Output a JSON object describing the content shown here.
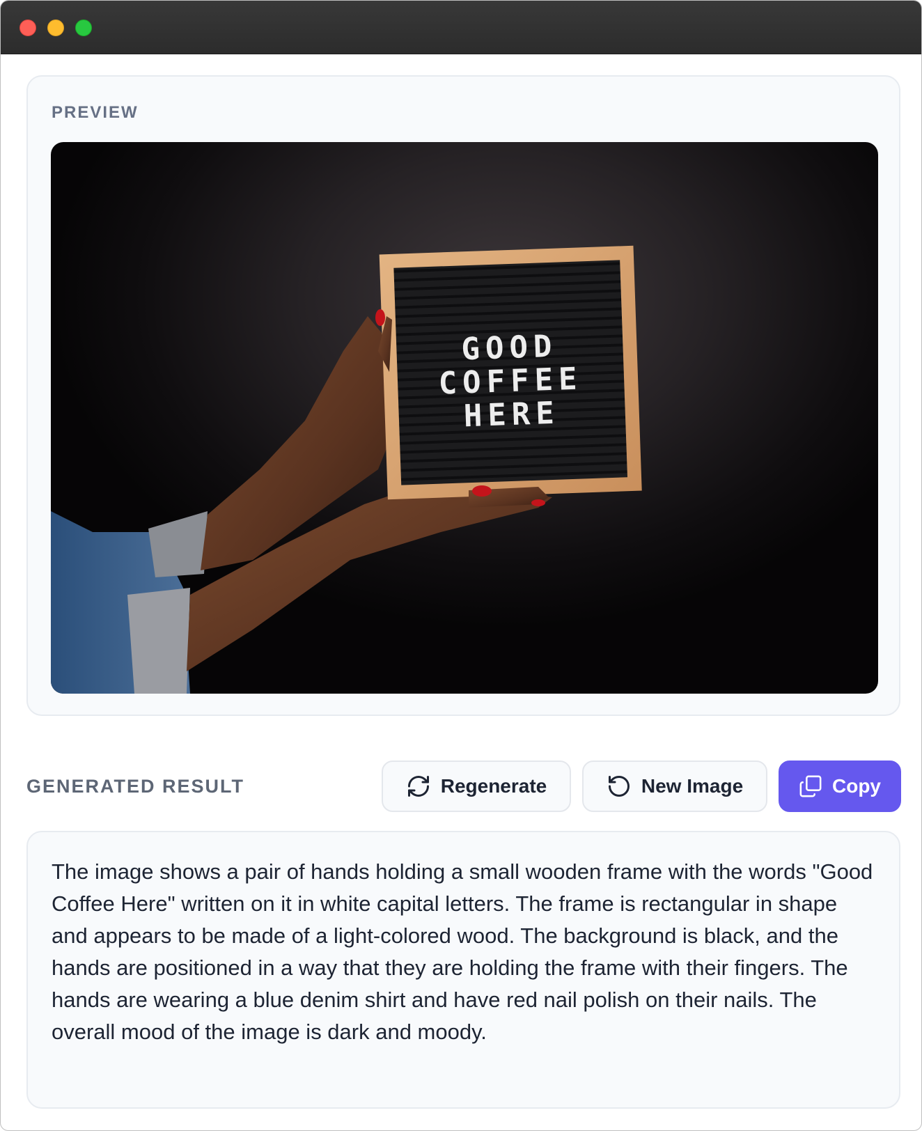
{
  "window": {
    "controls": [
      "close",
      "minimize",
      "zoom"
    ]
  },
  "preview": {
    "label": "PREVIEW",
    "image": {
      "letterboard_lines": [
        "GOOD",
        "COFFEE",
        "HERE"
      ]
    }
  },
  "result": {
    "label": "GENERATED RESULT",
    "buttons": {
      "regenerate": "Regenerate",
      "new_image": "New Image",
      "copy": "Copy"
    },
    "text": "The image shows a pair of hands holding a small wooden frame with the words \"Good Coffee Here\" written on it in white capital letters. The frame is rectangular in shape and appears to be made of a light-colored wood. The background is black, and the hands are positioned in a way that they are holding the frame with their fingers. The hands are wearing a blue denim shirt and have red nail polish on their nails. The overall mood of the image is dark and moody."
  },
  "colors": {
    "accent": "#6558ee",
    "card_background": "#f8fafc",
    "label_gray": "#667085",
    "text_dark": "#1d2433"
  },
  "icons": {
    "regenerate": "refresh-icon",
    "new_image": "rotate-ccw-icon",
    "copy": "copy-icon"
  }
}
